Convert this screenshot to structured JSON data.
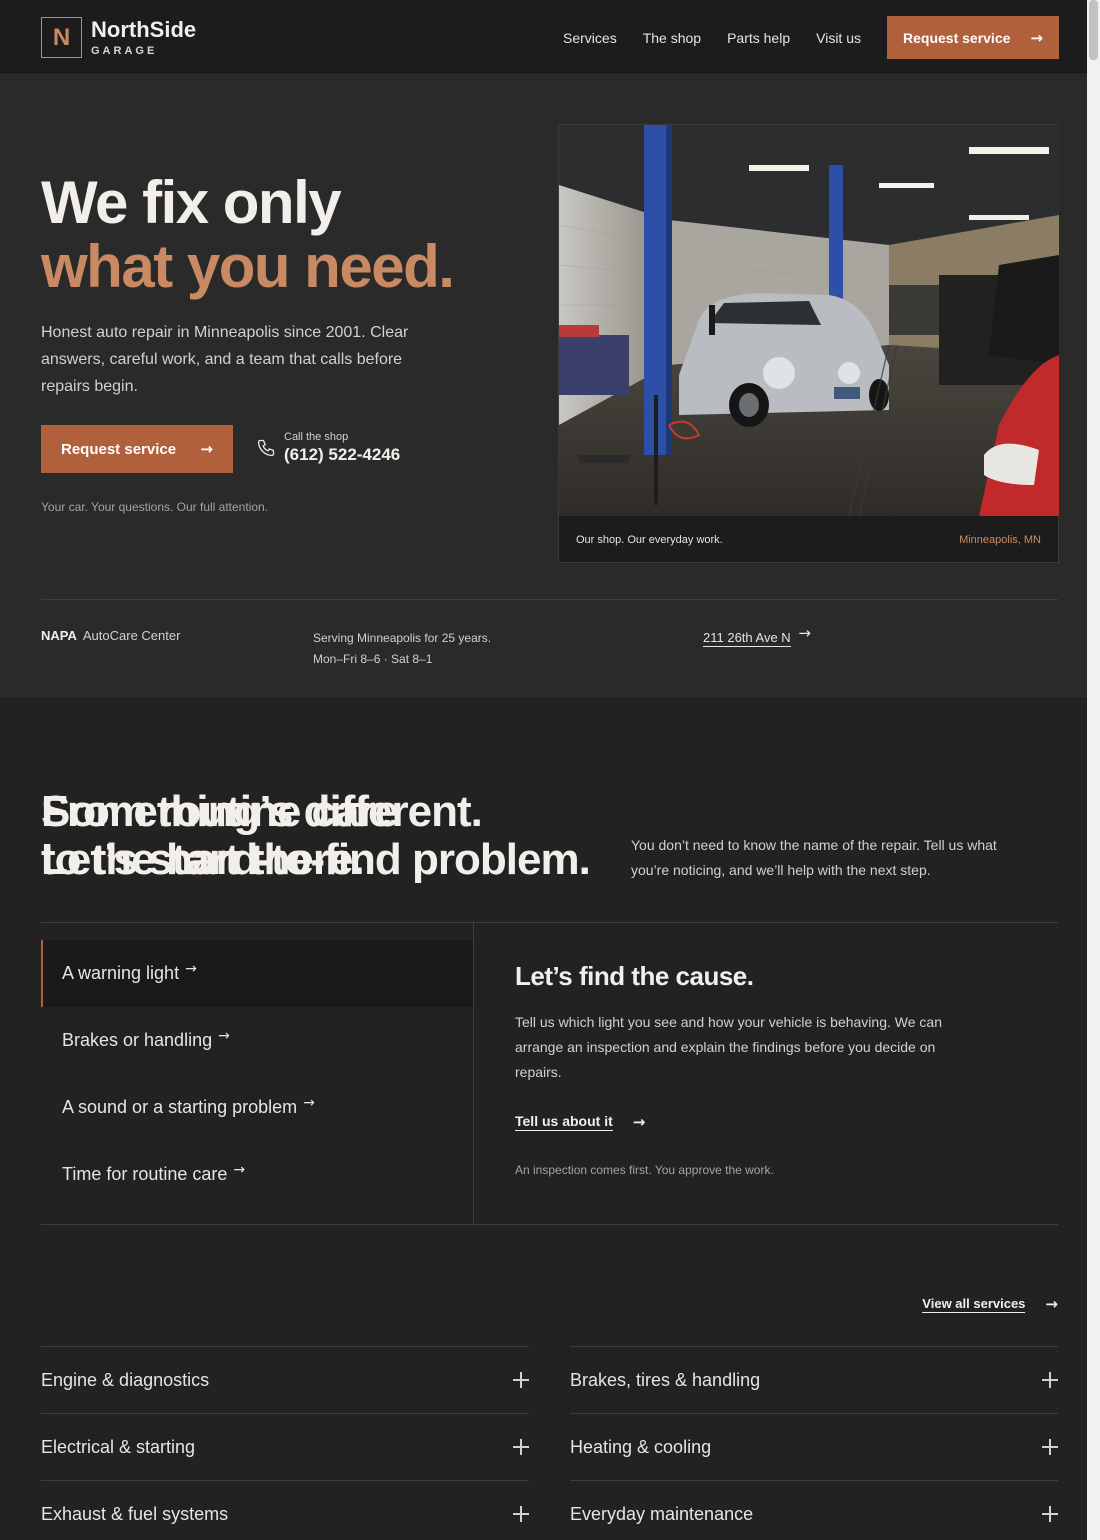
{
  "brand": {
    "letter": "N",
    "name": "NorthSide",
    "sub": "GARAGE"
  },
  "nav": {
    "links": [
      "Services",
      "The shop",
      "Parts help",
      "Visit us"
    ],
    "cta": "Request service"
  },
  "hero": {
    "title_line1": "We fix only",
    "title_line2": "what you need.",
    "lead": "Honest auto repair in Minneapolis since 2001. Clear answers, careful work, and a team that calls before repairs begin.",
    "cta": "Request service",
    "call_label": "Call the shop",
    "phone": "(612) 522-4246",
    "tagline": "Your car. Your questions. Our full attention.",
    "photo_caption": "Our shop. Our everyday work.",
    "photo_location": "Minneapolis, MN"
  },
  "trust": {
    "napa_bold": "NAPA",
    "napa_rest": "AutoCare Center",
    "serving": "Serving Minneapolis for 25 years.",
    "hours": "Mon–Fri 8–6 · Sat 8–1",
    "address": "211 26th Ave N"
  },
  "different": {
    "title_line1": "Something’s different.",
    "title_line2": "Let’s start there.",
    "intro": "You don’t need to know the name of the repair. Tell us what you’re noticing, and we’ll help with the next step.",
    "options": [
      "A warning light",
      "Brakes or handling",
      "A sound or a starting problem",
      "Time for routine care"
    ],
    "active_index": 0,
    "panel_title": "Let’s find the cause.",
    "panel_text": "Tell us which light you see and how your vehicle is behaving. We can arrange an inspection and explain the findings before you decide on repairs.",
    "panel_cta": "Tell us about it",
    "panel_note": "An inspection comes first. You approve the work."
  },
  "services": {
    "title_line1": "From routine care",
    "title_line2": "to the hard-to-find problem.",
    "view_all": "View all services",
    "left": [
      "Engine & diagnostics",
      "Electrical & starting",
      "Exhaust & fuel systems"
    ],
    "right": [
      "Brakes, tires & handling",
      "Heating & cooling",
      "Everyday maintenance"
    ]
  },
  "colors": {
    "accent": "#c98a63",
    "button": "#b0603a",
    "bg": "#252525",
    "header": "#1c1c1c"
  },
  "icons": {
    "arrow": "arrow-right-icon",
    "phone": "phone-icon",
    "plus": "plus-icon"
  }
}
